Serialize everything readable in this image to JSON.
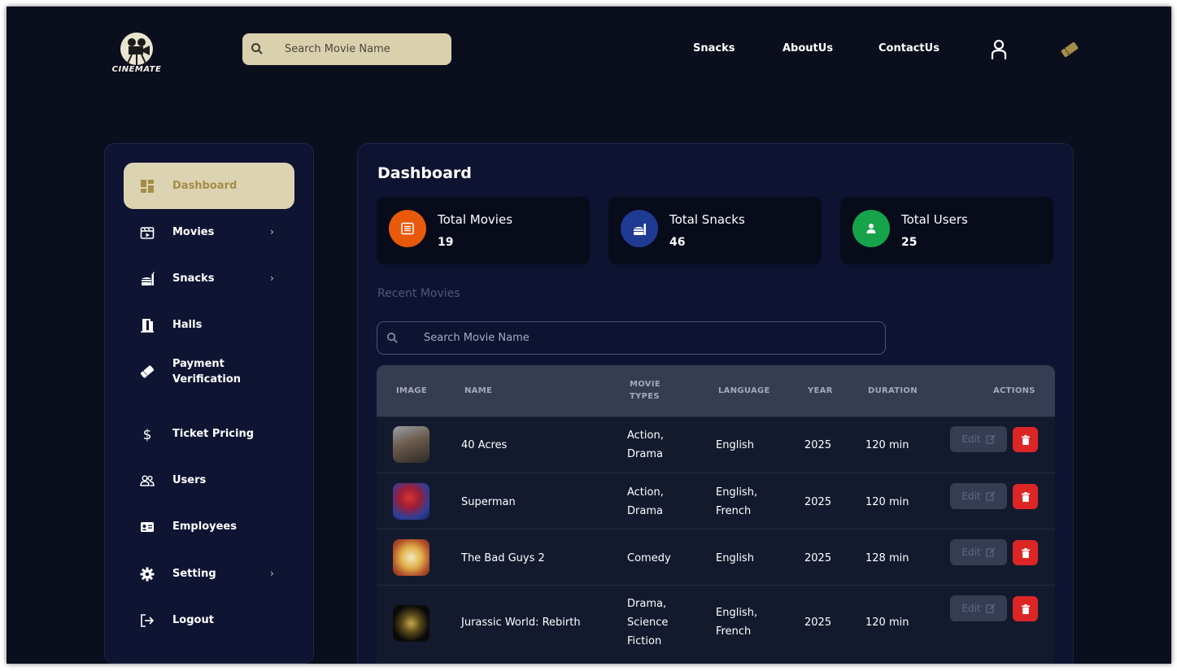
{
  "header": {
    "logo_text": "CINEMATE",
    "search_placeholder": "Search Movie Name",
    "nav": [
      {
        "label": "Snacks"
      },
      {
        "label": "AboutUs"
      },
      {
        "label": "ContactUs"
      }
    ],
    "icons": [
      "user-icon",
      "ticket-icon"
    ]
  },
  "sidebar": {
    "items": [
      {
        "label": "Dashboard",
        "icon": "dashboard-icon",
        "active": true,
        "has_chevron": false
      },
      {
        "label": "Movies",
        "icon": "film-icon",
        "active": false,
        "has_chevron": true
      },
      {
        "label": "Snacks",
        "icon": "snacks-icon",
        "active": false,
        "has_chevron": true
      },
      {
        "label": "Halls",
        "icon": "door-icon",
        "active": false,
        "has_chevron": false
      },
      {
        "label": "Payment Verification",
        "icon": "ticket-icon",
        "active": false,
        "has_chevron": false
      },
      {
        "label": "Ticket Pricing",
        "icon": "dollar-icon",
        "active": false,
        "has_chevron": false
      },
      {
        "label": "Users",
        "icon": "users-icon",
        "active": false,
        "has_chevron": false
      },
      {
        "label": "Employees",
        "icon": "id-card-icon",
        "active": false,
        "has_chevron": false
      },
      {
        "label": "Setting",
        "icon": "gear-icon",
        "active": false,
        "has_chevron": true
      },
      {
        "label": "Logout",
        "icon": "logout-icon",
        "active": false,
        "has_chevron": false
      }
    ],
    "chevron": "›"
  },
  "main": {
    "title": "Dashboard",
    "cards": [
      {
        "label": "Total Movies",
        "value": "19",
        "icon": "list-icon",
        "color": "#e8590c"
      },
      {
        "label": "Total Snacks",
        "value": "46",
        "icon": "snacks-icon",
        "color": "#1f3a93"
      },
      {
        "label": "Total Users",
        "value": "25",
        "icon": "user-icon",
        "color": "#16a34a"
      }
    ],
    "recent_title": "Recent Movies",
    "search_placeholder": "Search Movie Name",
    "table": {
      "headers": {
        "image": "IMAGE",
        "name": "NAME",
        "types_line1": "MOVIE",
        "types_line2": "TYPES",
        "language": "LANGUAGE",
        "year": "YEAR",
        "duration": "DURATION",
        "actions": "ACTIONS"
      },
      "rows": [
        {
          "name": "40 Acres",
          "types": [
            "Action,",
            "Drama"
          ],
          "language": [
            "English"
          ],
          "year": "2025",
          "duration": "120 min",
          "edit": "Edit"
        },
        {
          "name": "Superman",
          "types": [
            "Action,",
            "Drama"
          ],
          "language": [
            "English,",
            "French"
          ],
          "year": "2025",
          "duration": "120 min",
          "edit": "Edit"
        },
        {
          "name": "The Bad Guys 2",
          "types": [
            "Comedy"
          ],
          "language": [
            "English"
          ],
          "year": "2025",
          "duration": "128 min",
          "edit": "Edit"
        },
        {
          "name": "Jurassic World: Rebirth",
          "types": [
            "Drama,",
            "Science",
            "Fiction"
          ],
          "language": [
            "English,",
            "French"
          ],
          "year": "2025",
          "duration": "120 min",
          "edit": "Edit"
        }
      ]
    }
  },
  "colors": {
    "background": "#0b0e1d",
    "accent_beige": "#dcd3b2",
    "active_text": "#a48d47",
    "delete_red": "#dc2626"
  }
}
